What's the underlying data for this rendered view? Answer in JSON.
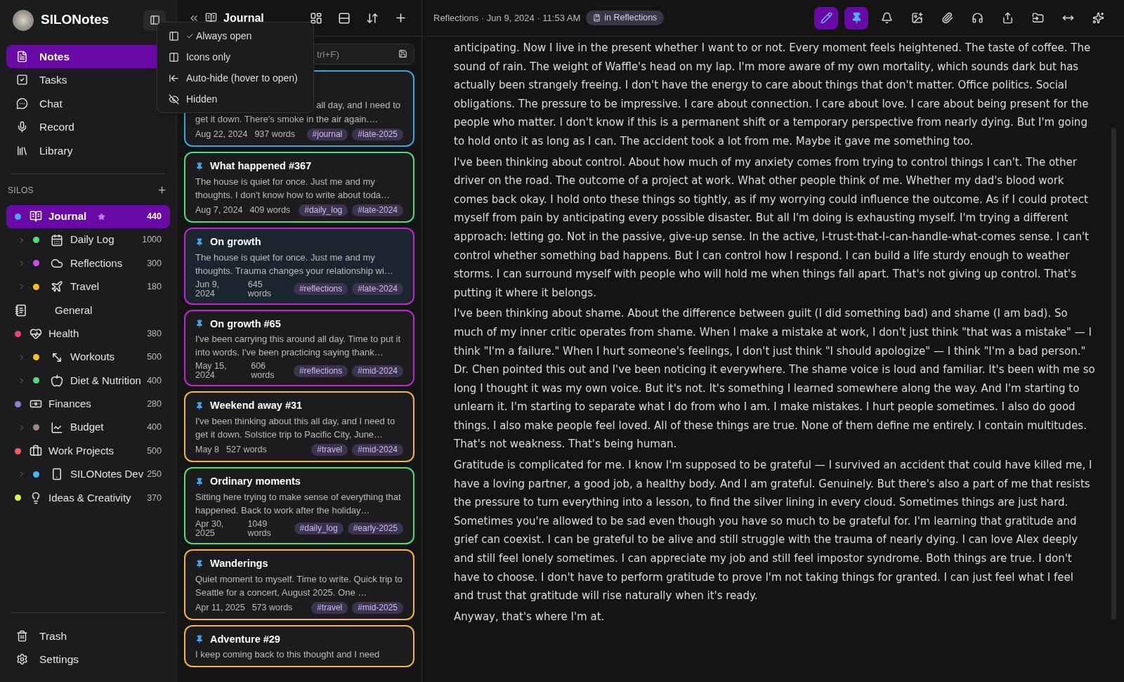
{
  "app": {
    "name": "SILONotes"
  },
  "nav": [
    {
      "label": "Notes",
      "selected": true
    },
    {
      "label": "Tasks",
      "selected": false
    },
    {
      "label": "Chat",
      "selected": false
    },
    {
      "label": "Record",
      "selected": false
    },
    {
      "label": "Library",
      "selected": false
    }
  ],
  "silos_heading": "SILOS",
  "silos": [
    {
      "label": "Journal",
      "count": "440",
      "color": "#4aa8f0",
      "selected": true,
      "starred": true,
      "children": [
        {
          "label": "Daily Log",
          "count": "1000",
          "color": "#4ade80",
          "selected": false,
          "starred": false
        },
        {
          "label": "Reflections",
          "count": "300",
          "color": "#d946ef",
          "selected": false,
          "starred": false
        },
        {
          "label": "Travel",
          "count": "180",
          "color": "#fbbf24",
          "selected": false,
          "starred": false
        }
      ]
    },
    {
      "label": "General",
      "selected": false,
      "starred": false
    },
    {
      "label": "Health",
      "count": "380",
      "color": "#f43f7a",
      "selected": false,
      "starred": false,
      "children": [
        {
          "label": "Workouts",
          "count": "500",
          "color": "#fbbf24",
          "selected": false,
          "starred": false
        },
        {
          "label": "Diet & Nutrition",
          "count": "400",
          "color": "#4ade80",
          "selected": false,
          "starred": false
        }
      ]
    },
    {
      "label": "Finances",
      "count": "280",
      "color": "#8b7fd6",
      "selected": false,
      "starred": false,
      "children": [
        {
          "label": "Budget",
          "count": "400",
          "color": "#a1887f",
          "selected": false,
          "starred": false
        }
      ]
    },
    {
      "label": "Work Projects",
      "count": "500",
      "color": "#f25c6a",
      "selected": false,
      "starred": false,
      "children": [
        {
          "label": "SILONotes Dev",
          "count": "250",
          "color": "#38bdf8",
          "selected": false,
          "starred": false
        }
      ]
    },
    {
      "label": "Ideas & Creativity",
      "count": "370",
      "color": "#d4f45c",
      "selected": false,
      "starred": false
    }
  ],
  "footer_nav": [
    {
      "label": "Trash"
    },
    {
      "label": "Settings"
    }
  ],
  "sidebar_menu": [
    {
      "label": "Always open",
      "checked": true
    },
    {
      "label": "Icons only",
      "checked": false
    },
    {
      "label": "Auto-hide (hover to open)",
      "checked": false
    },
    {
      "label": "Hidden",
      "checked": false
    }
  ],
  "note_list": {
    "title": "Journal",
    "search": {
      "placeholder": "trl+F)"
    },
    "cards": [
      {
        "preview_tail": "all day, and I need to",
        "preview": "get it down. There's smoke in the air again.…",
        "date": "Aug 22, 2024",
        "words": "937 words",
        "tags": [
          "#journal",
          "#late-2025"
        ],
        "color": "#3ba7d9",
        "selected": false
      },
      {
        "title": "What happened #367",
        "preview": "The house is quiet for once. Just me and my thoughts. I don't know how to write about toda…",
        "date": "Aug 7, 2024",
        "words": "409 words",
        "tags": [
          "#daily_log",
          "#late-2024"
        ],
        "color": "#4ade80",
        "selected": false,
        "pinned": true
      },
      {
        "title": "On growth",
        "preview": "The house is quiet for once. Just me and my thoughts. Trauma changes your relationship wi…",
        "date": "Jun 9, 2024",
        "words": "645 words",
        "tags": [
          "#reflections",
          "#late-2024"
        ],
        "color": "#c026d3",
        "selected": true,
        "pinned": true
      },
      {
        "title": "On growth #65",
        "preview": "I've been carrying this around all day. Time to put it into words. I've been practicing saying thank…",
        "date": "May 15, 2024",
        "words": "606 words",
        "tags": [
          "#reflections",
          "#mid-2024"
        ],
        "color": "#c026d3",
        "selected": false,
        "pinned": true
      },
      {
        "title": "Weekend away #31",
        "preview": "I've been thinking about this all day, and I need to get it down. Solstice trip to Pacific City, June…",
        "date": "May 8",
        "words": "527 words",
        "tags": [
          "#travel",
          "#mid-2024"
        ],
        "color": "#f4b73a",
        "selected": false,
        "pinned": true
      },
      {
        "title": "Ordinary moments",
        "preview": "Sitting here trying to make sense of everything that happened. Back to work after the holiday…",
        "date": "Apr 30, 2025",
        "words": "1049 words",
        "tags": [
          "#daily_log",
          "#early-2025"
        ],
        "color": "#4ade80",
        "selected": false,
        "pinned": true
      },
      {
        "title": "Wanderings",
        "preview": "Quiet moment to myself. Time to write. Quick trip to Seattle for a concert, August 2025. One …",
        "date": "Apr 11, 2025",
        "words": "573 words",
        "tags": [
          "#travel",
          "#mid-2025"
        ],
        "color": "#f4b73a",
        "selected": false,
        "pinned": true
      },
      {
        "title": "Adventure #29",
        "preview": "I keep coming back to this thought and I need",
        "color": "#f4b73a",
        "selected": false,
        "pinned": true
      }
    ]
  },
  "editor": {
    "meta": "Reflections · Jun 9, 2024 · 11:53 AM",
    "silo_badge": "in Reflections",
    "toolbar": [
      {
        "active": true
      },
      {
        "active": true
      },
      {
        "active": false
      },
      {
        "active": false
      },
      {
        "active": false
      },
      {
        "active": false
      },
      {
        "active": false
      },
      {
        "active": false
      },
      {
        "active": false
      },
      {
        "active": false
      }
    ],
    "paragraphs": [
      "anticipating. Now I live in the present whether I want to or not. Every moment feels heightened. The taste of coffee. The sound of rain. The weight of Waffle's head on my lap. I'm more aware of my own mortality, which sounds dark but has actually been strangely freeing. I don't have the energy to care about things that don't matter. Office politics. Social obligations. The pressure to be impressive. I care about connection. I care about love. I care about being present for the people who matter. I don't know if this is a permanent shift or a temporary perspective from nearly dying. But I'm going to hold onto it as long as I can. The accident took a lot from me. Maybe it gave me something too.",
      "I've been thinking about control. About how much of my anxiety comes from trying to control things I can't. The other driver on the road. The outcome of a project at work. What other people think of me. Whether my dad's blood work comes back okay. I hold onto these things so tightly, as if my worrying could influence the outcome. As if I could protect myself from pain by anticipating every possible disaster. But all I'm doing is exhausting myself. I'm trying a different approach: letting go. Not in the passive, give-up sense. In the active, I-trust-that-I-can-handle-what-comes sense. I can't control whether something bad happens. But I can control how I respond. I can build a life sturdy enough to weather storms. I can surround myself with people who will hold me when things fall apart. That's not giving up control. That's putting it where it belongs.",
      "I've been thinking about shame. About the difference between guilt (I did something bad) and shame (I am bad). So much of my inner critic operates from shame. When I make a mistake at work, I don't just think \"that was a mistake\" — I think \"I'm a failure.\" When I hurt someone's feelings, I don't just think \"I should apologize\" — I think \"I'm a bad person.\" Dr. Chen pointed this out and I've been noticing it everywhere. The shame voice is loud and familiar. It's been with me so long I thought it was my own voice. But it's not. It's something I learned somewhere along the way. And I'm starting to unlearn it. I'm starting to separate what I do from who I am. I make mistakes. I hurt people sometimes. I also do good things. I also make people feel loved. All of these things are true. None of them define me entirely. I contain multitudes. That's not weakness. That's being human.",
      "Gratitude is complicated for me. I know I'm supposed to be grateful — I survived an accident that could have killed me, I have a loving partner, a good job, a healthy body. And I am grateful. Genuinely. But there's also a part of me that resists the pressure to turn everything into a lesson, to find the silver lining in every cloud. Sometimes things are just hard. Sometimes you're allowed to be sad even though you have so much to be grateful for. I'm learning that gratitude and grief can coexist. I can be grateful to be alive and still struggle with the trauma of nearly dying. I can love Alex deeply and still feel lonely sometimes. I can appreciate my job and still feel impostor syndrome. Both things are true. I don't have to choose. I don't have to perform gratitude to prove I'm not taking things for granted. I can just feel what I feel and trust that gratitude will rise naturally when it's ready.",
      "Anyway, that's where I'm at."
    ]
  }
}
